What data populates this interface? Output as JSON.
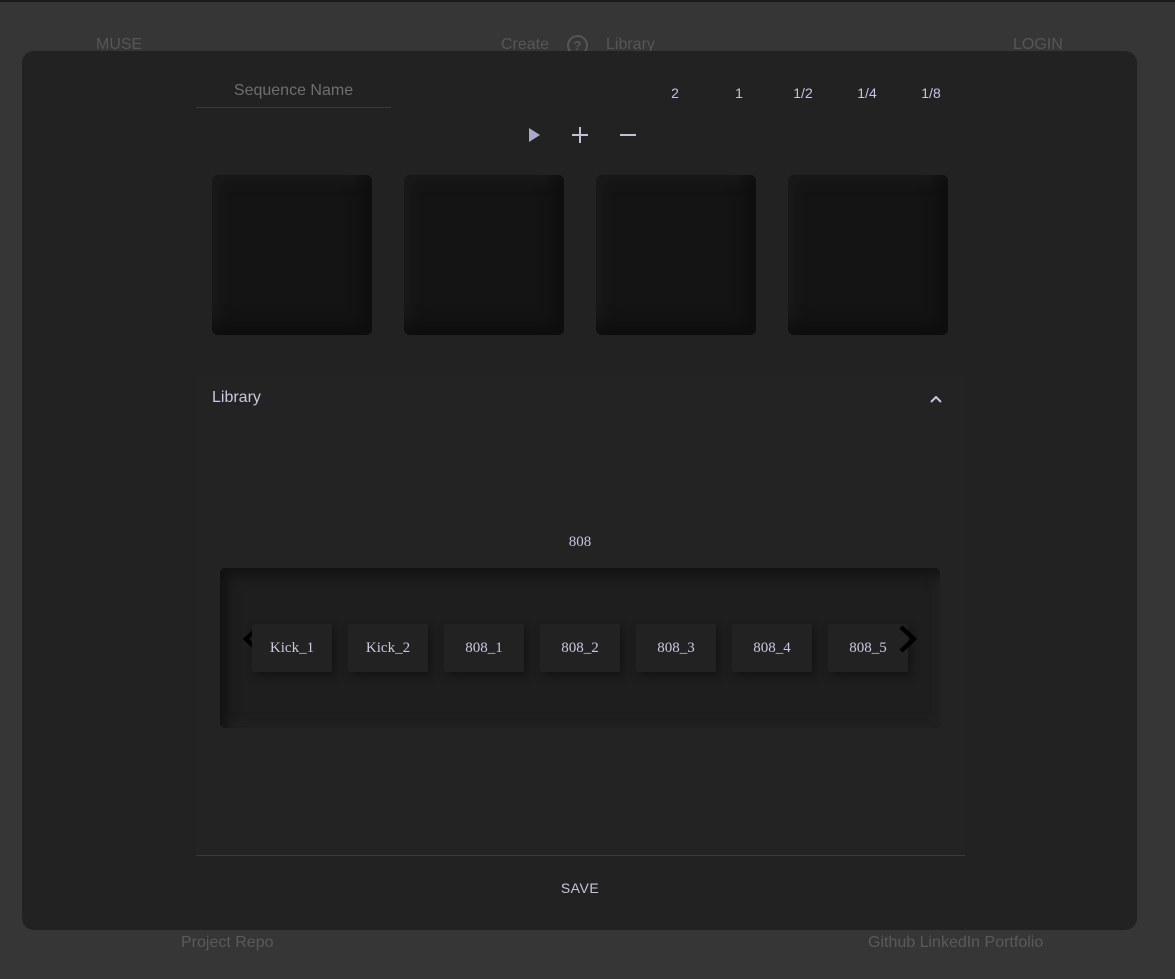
{
  "background": {
    "nav": {
      "brand": "MUSE",
      "create": "Create",
      "help_icon": "question-circle-icon",
      "library": "Library",
      "login": "LOGIN"
    },
    "footer": {
      "repo": "Project Repo",
      "links": "Github LinkedIn Portfolio"
    }
  },
  "sequencer": {
    "name_placeholder": "Sequence Name",
    "rates": [
      "2",
      "1",
      "1/2",
      "1/4",
      "1/8"
    ],
    "controls": {
      "play_icon": "play-icon",
      "add_icon": "plus-icon",
      "remove_icon": "minus-icon"
    },
    "pads": 4
  },
  "library": {
    "title": "Library",
    "collapse_icon": "chevron-up-icon",
    "category": "808",
    "samples": [
      "Kick_1",
      "Kick_2",
      "808_1",
      "808_2",
      "808_3",
      "808_4",
      "808_5"
    ],
    "prev_icon": "chevron-left-icon",
    "next_icon": "chevron-right-icon"
  },
  "actions": {
    "save": "SAVE"
  },
  "colors": {
    "page_bg": "#363636",
    "modal_bg": "#222222",
    "text_accent": "#c5c5df",
    "muted_text": "#565656"
  }
}
